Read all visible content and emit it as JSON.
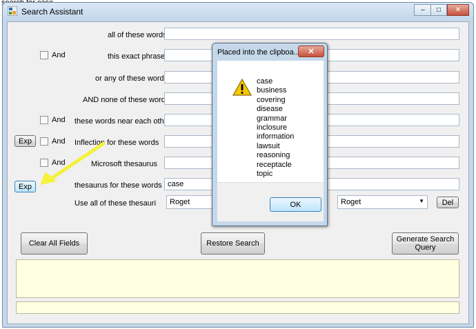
{
  "background": {
    "partial_text": "search for case"
  },
  "window": {
    "title": "Search Assistant",
    "controls": [
      "–",
      "□",
      "✕"
    ]
  },
  "form": {
    "rows": [
      {
        "label": "all of these words",
        "value": ""
      },
      {
        "label": "this exact phrase",
        "value": ""
      },
      {
        "label": "or any of these words",
        "value": ""
      },
      {
        "label": "AND none of these words",
        "value": ""
      },
      {
        "label": "these words near each other",
        "value": ""
      },
      {
        "label": "Inflection for these words",
        "value": ""
      },
      {
        "label": "Microsoft thesaurus",
        "value": ""
      },
      {
        "label": "thesaurus for these words",
        "value": "case"
      }
    ],
    "and_label": "And",
    "exp_label": "Exp",
    "thesauri_label": "Use all of these thesauri",
    "thesaurus_left": "Roget",
    "thesaurus_right": "Roget",
    "del_label": "Del"
  },
  "buttons": {
    "clear": "Clear All Fields",
    "restore": "Restore Search",
    "generate": "Generate Search Query"
  },
  "dialog": {
    "title": "Placed into the clipboa...",
    "close": "✕",
    "icon": "warning-icon",
    "items": [
      "case",
      "business",
      "covering",
      "disease",
      "grammar",
      "inclosure",
      "information",
      "lawsuit",
      "reasoning",
      "receptacle",
      "topic"
    ],
    "ok": "OK"
  },
  "colors": {
    "arrow": "#f4f23a",
    "result_area": "#ffffe1"
  }
}
